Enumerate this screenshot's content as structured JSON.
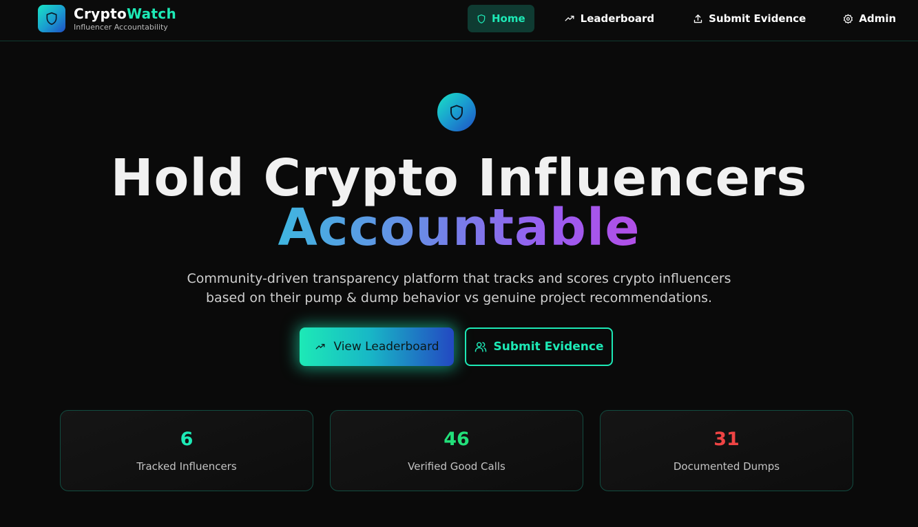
{
  "brand": {
    "title_main": "Crypto",
    "title_accent": "Watch",
    "subtitle": "Influencer Accountability"
  },
  "nav": {
    "items": [
      {
        "label": "Home",
        "icon": "shield-icon",
        "active": true
      },
      {
        "label": "Leaderboard",
        "icon": "trending-up-icon",
        "active": false
      },
      {
        "label": "Submit Evidence",
        "icon": "upload-icon",
        "active": false
      },
      {
        "label": "Admin",
        "icon": "gear-icon",
        "active": false
      }
    ]
  },
  "hero": {
    "icon": "shield-icon",
    "headline_line1": "Hold Crypto Influencers",
    "headline_line2": "Accountable",
    "description_line1": "Community-driven transparency platform that tracks and scores crypto influencers",
    "description_line2": "based on their pump & dump behavior vs genuine project recommendations.",
    "primary_button": {
      "label": "View Leaderboard",
      "icon": "trending-up-icon"
    },
    "secondary_button": {
      "label": "Submit Evidence",
      "icon": "users-icon"
    }
  },
  "stats": [
    {
      "value": "6",
      "label": "Tracked Influencers",
      "color": "#1de9b6"
    },
    {
      "value": "46",
      "label": "Verified Good Calls",
      "color": "#22e07a"
    },
    {
      "value": "31",
      "label": "Documented Dumps",
      "color": "#ef4444"
    }
  ],
  "colors": {
    "accent": "#1de9b6",
    "background": "#0a0a0a",
    "gradient_start": "#3fb6e0",
    "gradient_end": "#b24fe6"
  }
}
